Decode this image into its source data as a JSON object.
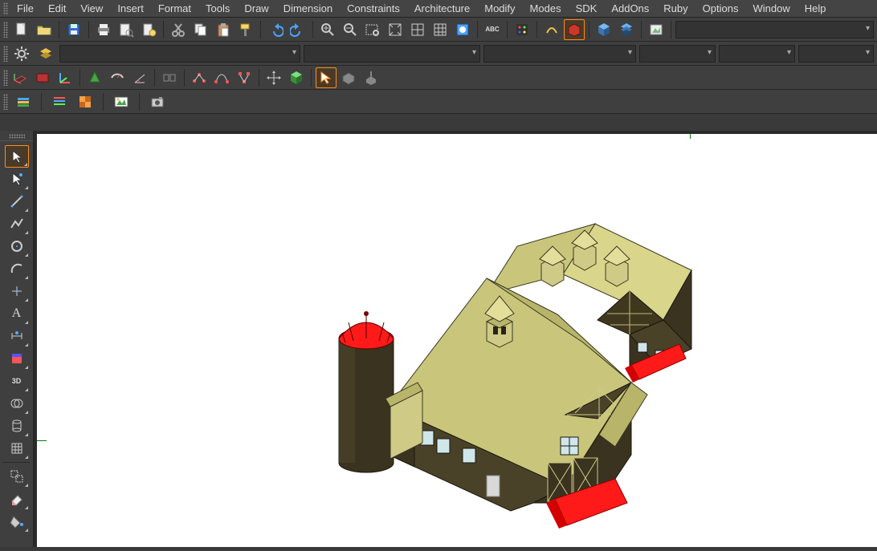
{
  "menu": {
    "items": [
      "File",
      "Edit",
      "View",
      "Insert",
      "Format",
      "Tools",
      "Draw",
      "Dimension",
      "Constraints",
      "Architecture",
      "Modify",
      "Modes",
      "SDK",
      "AddOns",
      "Ruby",
      "Options",
      "Window",
      "Help"
    ]
  },
  "toolbar1": {
    "icons": [
      "new-file",
      "open-folder",
      "save",
      "print",
      "print-preview",
      "document-setup",
      "cut",
      "copy",
      "paste",
      "format-painter",
      "undo",
      "redo",
      "zoom-in",
      "zoom-out",
      "zoom-window",
      "zoom-extents",
      "pan",
      "grid",
      "visual-style",
      "spellcheck",
      "materials",
      "edge-style",
      "face-mode",
      "shaded-cube",
      "layers-dialog",
      "render"
    ]
  },
  "toolbar3": {
    "icons": [
      "cplane",
      "section",
      "ucs",
      "cone-tool",
      "measure",
      "angle-dimension",
      "align",
      "polyline-edit",
      "curve-edit",
      "node-edit",
      "move",
      "box-3d",
      "select-path",
      "surface",
      "extrude"
    ]
  },
  "toolbar4": {
    "icons": [
      "render-settings",
      "layers-list",
      "texture-tool",
      "image-browser",
      "camera"
    ]
  },
  "lefttools": {
    "icons": [
      "pointer",
      "select-similar",
      "line",
      "polyline",
      "circle",
      "arc",
      "point",
      "text",
      "dimension-tool",
      "hatch",
      "solid-box",
      "boolean",
      "cylinder",
      "sphere",
      "mesh",
      "group",
      "explode",
      "eraser",
      "bucket"
    ]
  },
  "abc_label": "ABC",
  "3d_label": "3D"
}
